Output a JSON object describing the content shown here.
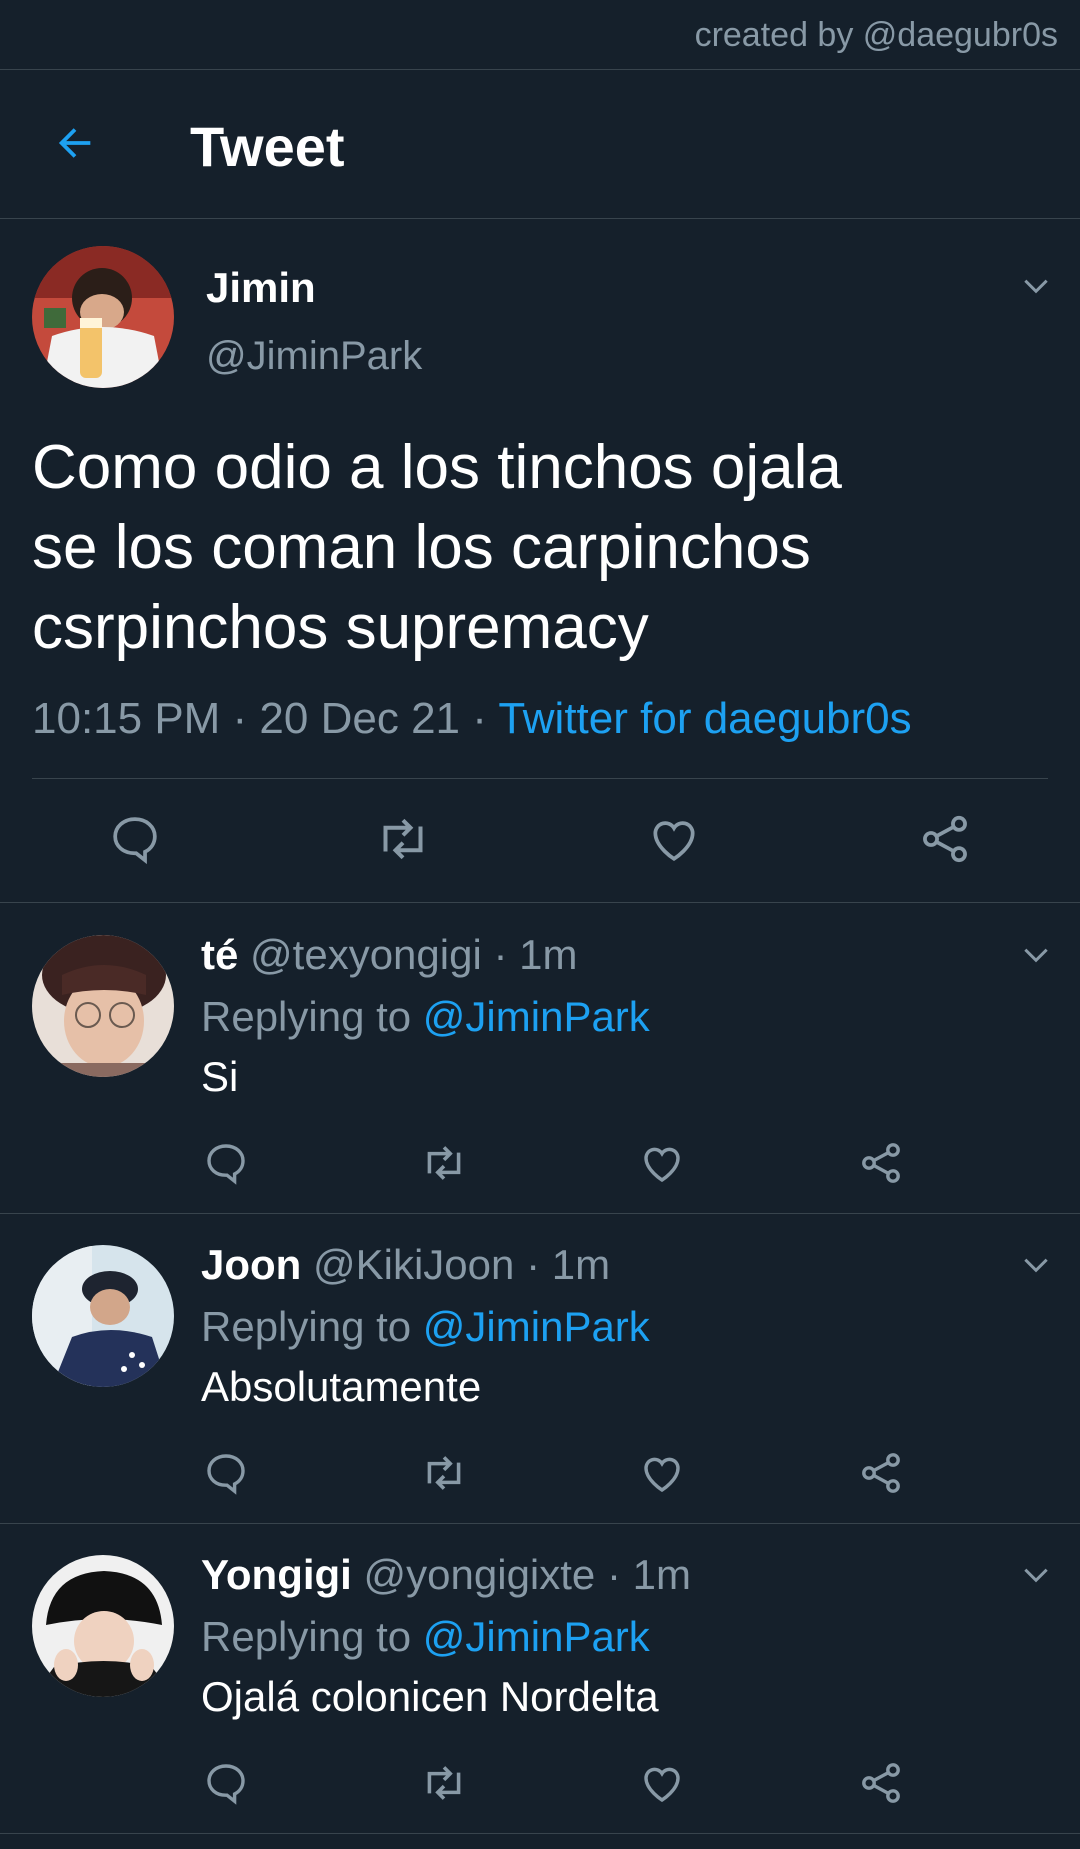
{
  "credit": "created by @daegubr0s",
  "header": {
    "title": "Tweet",
    "back_icon": "arrow-left-icon",
    "accent": "#1da1f2"
  },
  "tweet": {
    "name": "Jimin",
    "handle": "@JiminPark",
    "lines": [
      "Como odio a los tinchos ojala",
      "se los coman los carpinchos",
      "csrpinchos supremacy"
    ],
    "time": "10:15 PM · 20 Dec 21 · ",
    "source": "Twitter for daegubr0s",
    "actions": [
      "reply-icon",
      "retweet-icon",
      "like-icon",
      "share-icon"
    ]
  },
  "replies": [
    {
      "name": "té",
      "handle": "@texyongigi",
      "time": "· 1m",
      "replying_prefix": "Replying to ",
      "mention": "@JiminPark",
      "text": "Si"
    },
    {
      "name": "Joon",
      "handle": "@KikiJoon",
      "time": "· 1m",
      "replying_prefix": "Replying to ",
      "mention": "@JiminPark",
      "text": "Absolutamente"
    },
    {
      "name": "Yongigi",
      "handle": "@yongigixte",
      "time": "· 1m",
      "replying_prefix": "Replying to ",
      "mention": "@JiminPark",
      "text": "Ojalá colonicen Nordelta"
    }
  ],
  "colors": {
    "background": "#15202b",
    "divider": "#38444d",
    "muted": "#8899a6",
    "link": "#1da1f2"
  }
}
